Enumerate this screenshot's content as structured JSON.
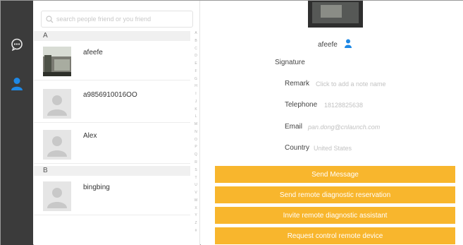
{
  "search": {
    "placeholder": "search people friend or you friend"
  },
  "sections": [
    {
      "letter": "A",
      "contacts": [
        {
          "name": "afeefe"
        },
        {
          "name": "a9856910016OO"
        },
        {
          "name": "Alex"
        }
      ]
    },
    {
      "letter": "B",
      "contacts": [
        {
          "name": "bingbing"
        }
      ]
    }
  ],
  "alpha_index": [
    "A",
    "B",
    "C",
    "D",
    "E",
    "F",
    "G",
    "H",
    "I",
    "J",
    "K",
    "L",
    "M",
    "N",
    "O",
    "P",
    "Q",
    "R",
    "S",
    "T",
    "U",
    "V",
    "W",
    "X",
    "Y",
    "Z",
    "#"
  ],
  "detail": {
    "name": "afeefe",
    "signature_label": "Signature",
    "fields": [
      {
        "label": "Remark",
        "value": "Click to add a note name"
      },
      {
        "label": "Telephone",
        "value": "18128825638"
      },
      {
        "label": "Email",
        "value": "pan.dong@cnlaunch.com"
      },
      {
        "label": "Country",
        "value": "United States"
      }
    ],
    "actions": [
      "Send Message",
      "Send remote diagnostic reservation",
      "Invite remote diagnostic assistant",
      "Request control remote device"
    ]
  },
  "colors": {
    "sidebar": "#3b3b3b",
    "accent_blue": "#1e88e5",
    "button_orange": "#f8b62d"
  },
  "icons": {
    "chat": "chat-bubble-icon",
    "contacts": "person-icon",
    "search": "search-icon",
    "gender": "male-person-icon"
  }
}
